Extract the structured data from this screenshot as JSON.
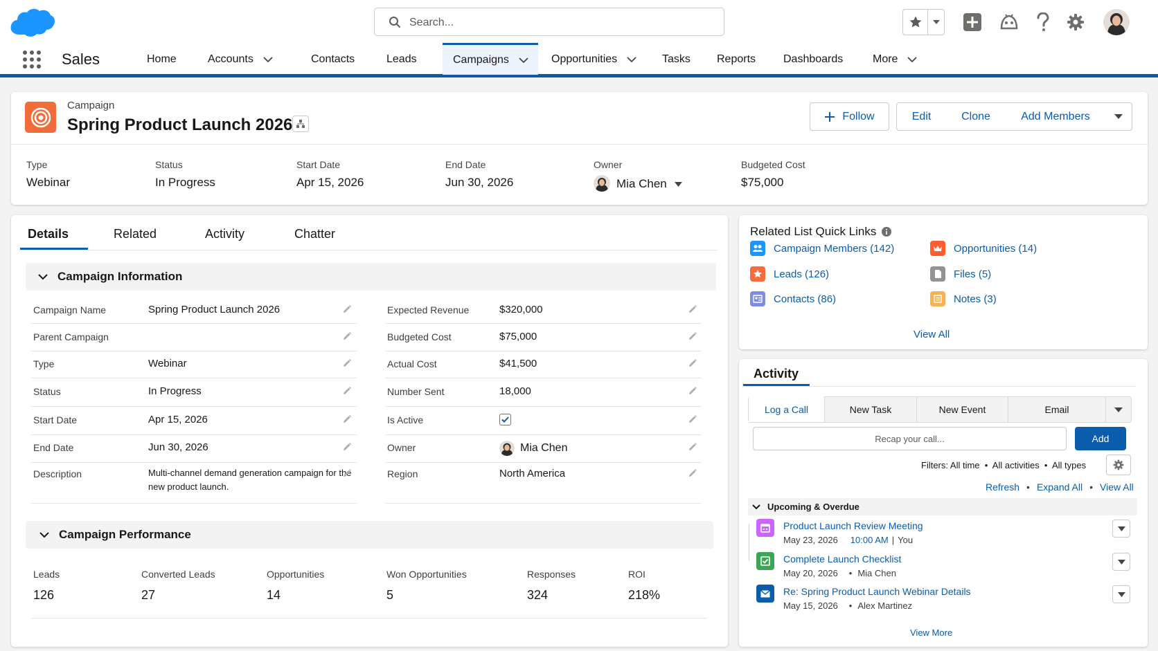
{
  "header": {
    "app_name": "Sales",
    "search_placeholder": "Search...",
    "nav": [
      {
        "label": "Home"
      },
      {
        "label": "Accounts"
      },
      {
        "label": "Contacts"
      },
      {
        "label": "Leads"
      },
      {
        "label": "Campaigns"
      },
      {
        "label": "Opportunities"
      },
      {
        "label": "Tasks"
      },
      {
        "label": "Reports"
      },
      {
        "label": "Dashboards"
      },
      {
        "label": "More"
      }
    ]
  },
  "record": {
    "object_label": "Campaign",
    "title": "Spring Product Launch 2026",
    "actions": {
      "follow": "Follow",
      "edit": "Edit",
      "clone": "Clone",
      "add_members": "Add Members"
    },
    "highlights": [
      {
        "label": "Type",
        "value": "Webinar"
      },
      {
        "label": "Status",
        "value": "In Progress"
      },
      {
        "label": "Start Date",
        "value": "Apr 15, 2026"
      },
      {
        "label": "End Date",
        "value": "Jun 30, 2026"
      },
      {
        "label": "Owner",
        "value": "Mia Chen"
      },
      {
        "label": "Budgeted Cost",
        "value": "$75,000"
      }
    ]
  },
  "tabs": [
    "Details",
    "Related",
    "Activity",
    "Chatter"
  ],
  "campaign_info": {
    "title": "Campaign Information",
    "left": [
      {
        "label": "Campaign Name",
        "value": "Spring Product Launch 2026"
      },
      {
        "label": "Parent Campaign",
        "value": ""
      },
      {
        "label": "Type",
        "value": "Webinar"
      },
      {
        "label": "Status",
        "value": "In Progress"
      },
      {
        "label": "Start Date",
        "value": "Apr 15, 2026"
      },
      {
        "label": "End Date",
        "value": "Jun 30, 2026"
      },
      {
        "label": "Description",
        "value": "Multi-channel demand generation campaign for the new product launch."
      }
    ],
    "right": [
      {
        "label": "Expected Revenue",
        "value": "$320,000"
      },
      {
        "label": "Budgeted Cost",
        "value": "$75,000"
      },
      {
        "label": "Actual Cost",
        "value": "$41,500"
      },
      {
        "label": "Number Sent",
        "value": "18,000"
      },
      {
        "label": "Is Active",
        "value": ""
      },
      {
        "label": "Owner",
        "value": "Mia Chen"
      },
      {
        "label": "Region",
        "value": "North America"
      }
    ],
    "is_active": true
  },
  "campaign_performance": {
    "title": "Campaign Performance",
    "metrics": [
      {
        "label": "Leads",
        "value": "126"
      },
      {
        "label": "Converted Leads",
        "value": "27"
      },
      {
        "label": "Opportunities",
        "value": "14"
      },
      {
        "label": "Won Opportunities",
        "value": "5"
      },
      {
        "label": "Responses",
        "value": "324"
      },
      {
        "label": "ROI",
        "value": "218%"
      }
    ]
  },
  "quick_links": {
    "title": "Related List Quick Links",
    "items": [
      {
        "label": "Campaign Members (142)",
        "icon": "members-icon",
        "color": "#1b96ff"
      },
      {
        "label": "Opportunities (14)",
        "icon": "crown-icon",
        "color": "#ff5d2d"
      },
      {
        "label": "Leads (126)",
        "icon": "star-icon",
        "color": "#f86c3c"
      },
      {
        "label": "Files (5)",
        "icon": "file-icon",
        "color": "#939393"
      },
      {
        "label": "Contacts (86)",
        "icon": "contact-card-icon",
        "color": "#7f8de1"
      },
      {
        "label": "Notes (3)",
        "icon": "note-icon",
        "color": "#f6b355"
      }
    ],
    "view_all": "View All"
  },
  "activity": {
    "title": "Activity",
    "tabs": [
      "Log a Call",
      "New Task",
      "New Event",
      "Email"
    ],
    "input_placeholder": "Recap your call...",
    "add_label": "Add",
    "filters": "Filters: All time  •  All activities  •  All types",
    "refresh": "Refresh",
    "expand_all": "Expand All",
    "view_all": "View All",
    "upcoming_title": "Upcoming & Overdue",
    "items": [
      {
        "title": "Product Launch Review Meeting",
        "date": "May 23, 2026",
        "extra": "10:00 AM",
        "who": "You",
        "icon": "calendar-icon",
        "color": "#cb65ff"
      },
      {
        "title": "Complete Launch Checklist",
        "date": "May 20, 2026",
        "extra": "",
        "who": "Mia Chen",
        "icon": "task-check-icon",
        "color": "#3ba755"
      },
      {
        "title": "Re: Spring Product Launch Webinar Details",
        "date": "May 15, 2026",
        "extra": "",
        "who": "Alex Martinez",
        "icon": "email-icon",
        "color": "#0b5cab"
      }
    ],
    "view_more": "View More"
  },
  "colors": {
    "brand": "#0b5cab",
    "campaign_icon": "#f26c39",
    "cloud": "#1b96ff"
  }
}
